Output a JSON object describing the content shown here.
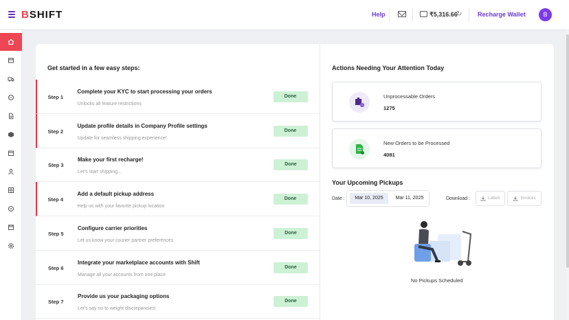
{
  "header": {
    "logo_prefix": "B",
    "logo_text": "SHIFT",
    "help_label": "Help",
    "balance": "₹5,316.66",
    "recharge_label": "Recharge Wallet",
    "avatar_initial": "B"
  },
  "sidebar": {
    "items": [
      "home-icon",
      "orders-icon",
      "shipments-icon",
      "returns-icon",
      "document-icon",
      "package-icon",
      "calendar-icon",
      "customer-icon",
      "billing-icon",
      "tag-icon",
      "calendar-alt-icon",
      "settings-icon"
    ]
  },
  "steps_panel": {
    "heading": "Get started in a few easy steps:",
    "steps": [
      {
        "num": "Step 1",
        "title": "Complete your KYC to start processing your orders",
        "sub": "Unlocks all feature restrictions",
        "status": "Done"
      },
      {
        "num": "Step 2",
        "title": "Update profile details in Company Profile settings",
        "sub": "Update for seamless shipping experience!",
        "status": "Done"
      },
      {
        "num": "Step 3",
        "title": "Make your first recharge!",
        "sub": "Let's start shipping...",
        "status": "Done"
      },
      {
        "num": "Step 4",
        "title": "Add a default pickup address",
        "sub": "Help us with your favorite pickup location",
        "status": "Done"
      },
      {
        "num": "Step 5",
        "title": "Configure carrier priorities",
        "sub": "Let us know your courier partner preferences",
        "status": "Done"
      },
      {
        "num": "Step 6",
        "title": "Integrate your marketplace accounts with Shift",
        "sub": "Manage all your accounts from one place",
        "status": "Done"
      },
      {
        "num": "Step 7",
        "title": "Provide us your packaging options",
        "sub": "Let's say no to weight discrepancies!",
        "status": "Done"
      }
    ]
  },
  "attention": {
    "heading": "Actions Needing Your Attention Today",
    "cards": [
      {
        "label": "Unprocessable Orders",
        "value": "1275"
      },
      {
        "label": "New Orders to be Processed",
        "value": "4081"
      }
    ]
  },
  "pickups": {
    "heading": "Your Upcoming Pickups",
    "date_label": "Date :",
    "date_from": "Mar 10, 2025",
    "date_to": "Mar 11, 2025",
    "download_label": "Download :",
    "labels_btn": "Labels",
    "invoices_btn": "Invoices",
    "empty_text": "No Pickups Scheduled"
  },
  "colors": {
    "accent": "#6a3bd6",
    "brand_red": "#ee4654",
    "done_bg": "#cdf1d5"
  }
}
